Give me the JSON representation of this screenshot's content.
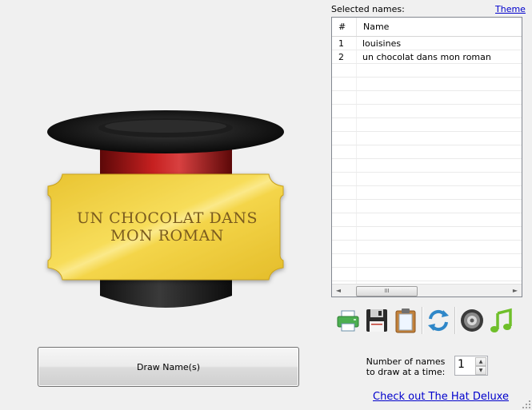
{
  "ticket": {
    "text": "UN CHOCOLAT DANS MON ROMAN"
  },
  "draw_button": {
    "label": "Draw Name(s)"
  },
  "selected": {
    "label": "Selected names:",
    "theme_link": "Theme",
    "columns": [
      "#",
      "Name"
    ],
    "rows": [
      {
        "num": "1",
        "name": "louisines"
      },
      {
        "num": "2",
        "name": "un chocolat dans mon roman"
      }
    ],
    "scroll_left": "◄",
    "scroll_right": "►",
    "scroll_thumb": "III"
  },
  "toolbar": {
    "icons": [
      "printer-icon",
      "save-icon",
      "clipboard-icon",
      "refresh-icon",
      "speaker-icon",
      "music-icon"
    ]
  },
  "draw_count": {
    "label_line1": "Number of names",
    "label_line2": "to draw at a time:",
    "value": "1",
    "up": "▲",
    "down": "▼"
  },
  "deluxe_link": "Check out The Hat Deluxe",
  "colors": {
    "ticket_gold": "#f3d547",
    "ribbon_red": "#b01818",
    "link_blue": "#0000cc"
  }
}
